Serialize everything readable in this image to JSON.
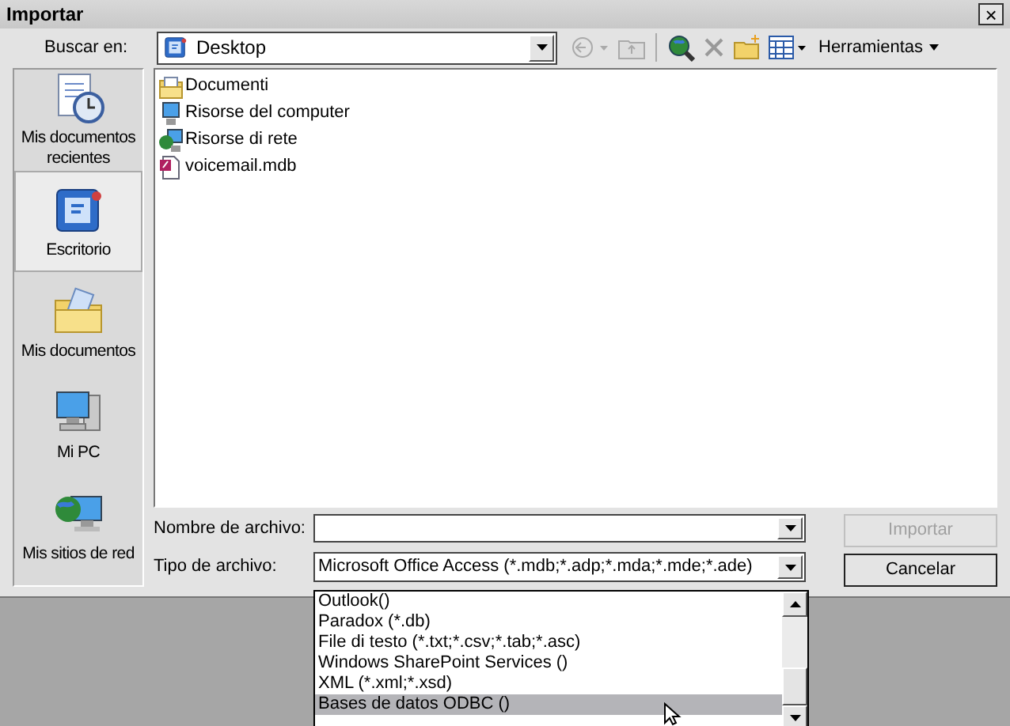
{
  "window": {
    "title": "Importar",
    "close": "×"
  },
  "toolbar": {
    "look_in_label": "Buscar en:",
    "look_in_value": "Desktop",
    "tools_label": "Herramientas"
  },
  "places": [
    {
      "label": "Mis documentos recientes",
      "kind": "recent",
      "selected": false
    },
    {
      "label": "Escritorio",
      "kind": "desktop",
      "selected": true
    },
    {
      "label": "Mis documentos",
      "kind": "documents",
      "selected": false
    },
    {
      "label": "Mi PC",
      "kind": "computer",
      "selected": false
    },
    {
      "label": "Mis sitios de red",
      "kind": "network",
      "selected": false
    }
  ],
  "files": [
    {
      "name": "Documenti",
      "kind": "folder"
    },
    {
      "name": "Risorse del computer",
      "kind": "computer"
    },
    {
      "name": "Risorse di rete",
      "kind": "network"
    },
    {
      "name": "voicemail.mdb",
      "kind": "database"
    }
  ],
  "file_name": {
    "label": "Nombre de archivo:"
  },
  "file_type": {
    "label": "Tipo de archivo:",
    "value": "Microsoft Office Access (*.mdb;*.adp;*.mda;*.mde;*.ade)"
  },
  "file_type_options": [
    {
      "label": "Outlook()",
      "selected": false
    },
    {
      "label": "Paradox (*.db)",
      "selected": false
    },
    {
      "label": "File di testo (*.txt;*.csv;*.tab;*.asc)",
      "selected": false
    },
    {
      "label": "Windows SharePoint Services ()",
      "selected": false
    },
    {
      "label": "XML (*.xml;*.xsd)",
      "selected": false
    },
    {
      "label": "Bases de datos ODBC ()",
      "selected": true
    }
  ],
  "buttons": [
    {
      "label": "Importar",
      "disabled": true
    },
    {
      "label": "Cancelar",
      "disabled": false
    }
  ]
}
